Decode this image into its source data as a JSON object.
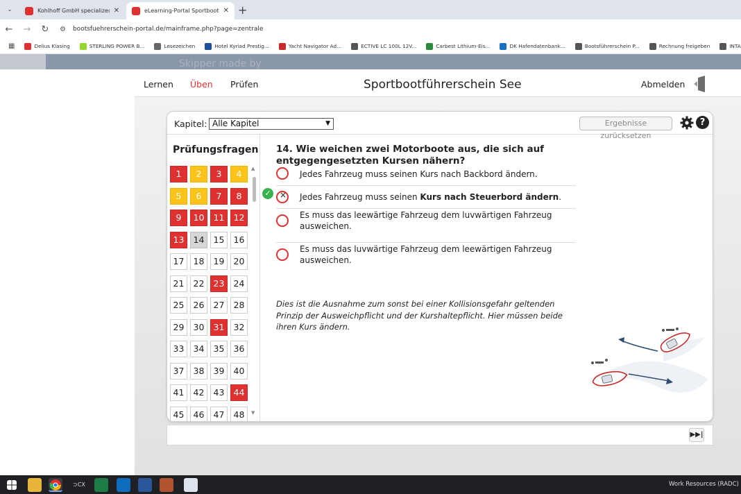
{
  "browser": {
    "tabs": [
      {
        "title": "Kohlhoff GmbH specialized in",
        "active": false,
        "icon_color": "#e03131"
      },
      {
        "title": "eLearning-Portal Sportbootführ",
        "active": true,
        "icon_color": "#e03131"
      }
    ],
    "url": "bootsfuehrerschein-portal.de/mainframe.php?page=zentrale",
    "bookmarks": [
      {
        "label": "Delius Klasing",
        "icon_color": "#e03131"
      },
      {
        "label": "STERLING POWER B...",
        "icon_color": "#94d82d"
      },
      {
        "label": "Lesezeichen",
        "icon_color": "#666666"
      },
      {
        "label": "Hotel Kyriad Prestig...",
        "icon_color": "#1c4f9c"
      },
      {
        "label": "Yacht Navigator Ad...",
        "icon_color": "#c92a2a"
      },
      {
        "label": "ECTIVE LC 100L 12V...",
        "icon_color": "#555555"
      },
      {
        "label": "Carbest Lithium-Eis...",
        "icon_color": "#2b8a3e"
      },
      {
        "label": "DK Hafendatenbank...",
        "icon_color": "#1971c2"
      },
      {
        "label": "Bootsführerschein P...",
        "icon_color": "#555555"
      },
      {
        "label": "Rechnung freigeben",
        "icon_color": "#555555"
      },
      {
        "label": "INTACT AGM-Pow",
        "icon_color": "#555555"
      }
    ]
  },
  "page": {
    "ghost_text": "Skipper made by"
  },
  "header": {
    "nav": [
      "Lernen",
      "Üben",
      "Prüfen"
    ],
    "active_nav": "Üben",
    "title": "Sportbootführerschein See",
    "logout_label": "Abmelden"
  },
  "toolbar": {
    "kapitel_label": "Kapitel:",
    "kapitel_value": "Alle Kapitel",
    "reset_label": "Ergebnisse zurücksetzen"
  },
  "questions_panel": {
    "title": "Prüfungsfragen",
    "questions": [
      {
        "n": "1",
        "state": "red"
      },
      {
        "n": "2",
        "state": "yellow"
      },
      {
        "n": "3",
        "state": "red"
      },
      {
        "n": "4",
        "state": "yellow"
      },
      {
        "n": "5",
        "state": "yellow"
      },
      {
        "n": "6",
        "state": "yellow"
      },
      {
        "n": "7",
        "state": "red"
      },
      {
        "n": "8",
        "state": "red"
      },
      {
        "n": "9",
        "state": "red"
      },
      {
        "n": "10",
        "state": "red"
      },
      {
        "n": "11",
        "state": "red"
      },
      {
        "n": "12",
        "state": "red"
      },
      {
        "n": "13",
        "state": "red"
      },
      {
        "n": "14",
        "state": "current"
      },
      {
        "n": "15",
        "state": "none"
      },
      {
        "n": "16",
        "state": "none"
      },
      {
        "n": "17",
        "state": "none"
      },
      {
        "n": "18",
        "state": "none"
      },
      {
        "n": "19",
        "state": "none"
      },
      {
        "n": "20",
        "state": "none"
      },
      {
        "n": "21",
        "state": "none"
      },
      {
        "n": "22",
        "state": "none"
      },
      {
        "n": "23",
        "state": "red"
      },
      {
        "n": "24",
        "state": "none"
      },
      {
        "n": "25",
        "state": "none"
      },
      {
        "n": "26",
        "state": "none"
      },
      {
        "n": "27",
        "state": "none"
      },
      {
        "n": "28",
        "state": "none"
      },
      {
        "n": "29",
        "state": "none"
      },
      {
        "n": "30",
        "state": "none"
      },
      {
        "n": "31",
        "state": "red"
      },
      {
        "n": "32",
        "state": "none"
      },
      {
        "n": "33",
        "state": "none"
      },
      {
        "n": "34",
        "state": "none"
      },
      {
        "n": "35",
        "state": "none"
      },
      {
        "n": "36",
        "state": "none"
      },
      {
        "n": "37",
        "state": "none"
      },
      {
        "n": "38",
        "state": "none"
      },
      {
        "n": "39",
        "state": "none"
      },
      {
        "n": "40",
        "state": "none"
      },
      {
        "n": "41",
        "state": "none"
      },
      {
        "n": "42",
        "state": "none"
      },
      {
        "n": "43",
        "state": "none"
      },
      {
        "n": "44",
        "state": "red"
      },
      {
        "n": "45",
        "state": "none"
      },
      {
        "n": "46",
        "state": "none"
      },
      {
        "n": "47",
        "state": "none"
      },
      {
        "n": "48",
        "state": "none"
      }
    ]
  },
  "question": {
    "text": "14. Wie weichen zwei Motorboote aus, die sich auf entgegengesetzten Kursen nähern?",
    "answers": [
      {
        "pre": "Jedes Fahrzeug muss seinen Kurs nach Backbord ändern.",
        "bold": "",
        "post": "",
        "selected": false,
        "correct": false
      },
      {
        "pre": "Jedes Fahrzeug muss seinen ",
        "bold": "Kurs nach Steuerbord ändern",
        "post": ".",
        "selected": true,
        "correct": true
      },
      {
        "pre": "Es muss das leewärtige Fahrzeug dem luvwärtigen Fahrzeug ausweichen.",
        "bold": "",
        "post": "",
        "selected": false,
        "correct": false
      },
      {
        "pre": "Es muss das luvwärtige Fahrzeug dem leewärtigen Fahrzeug ausweichen.",
        "bold": "",
        "post": "",
        "selected": false,
        "correct": false
      }
    ],
    "explanation": "Dies ist die Ausnahme zum sonst bei einer Kollisionsgefahr geltenden Prinzip der Ausweichpflicht und der Kurshaltepflicht. Hier müssen beide ihren Kurs ändern."
  },
  "taskbar": {
    "tray_text": "Work Resources (RADC)"
  },
  "colors": {
    "wrong": "#e03131",
    "partial": "#fcc419",
    "correct": "#37b24d",
    "active_nav": "#e03131"
  }
}
